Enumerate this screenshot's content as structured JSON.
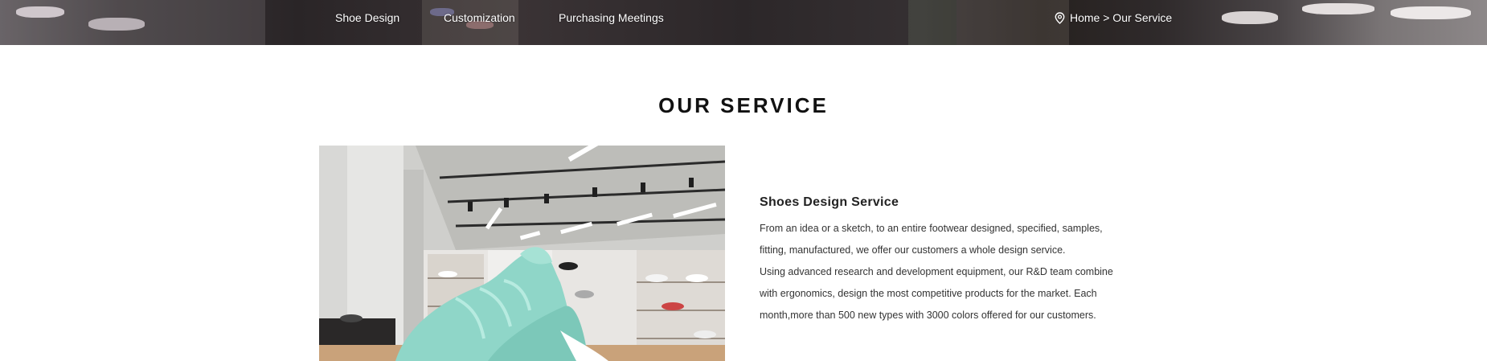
{
  "nav": {
    "items": [
      {
        "label": "Shoe Design"
      },
      {
        "label": "Customization"
      },
      {
        "label": "Purchasing Meetings"
      }
    ]
  },
  "breadcrumb": {
    "icon": "location-pin-icon",
    "text": "Home > Our Service"
  },
  "section": {
    "title": "OUR SERVICE"
  },
  "service": {
    "heading": "Shoes Design Service",
    "lines": [
      "From an idea or a sketch, to an entire footwear designed, specified,  samples,",
      "fitting, manufactured, we offer our customers a whole design service.",
      "Using advanced research and development equipment, our R&D team combine",
      "with ergonomics, design the most competitive products for the market. Each",
      "month,more than 500 new types with 3000 colors offered  for our customers."
    ]
  },
  "colors": {
    "shoe": "#8fd6c8",
    "text": "#333333",
    "title": "#111111"
  }
}
